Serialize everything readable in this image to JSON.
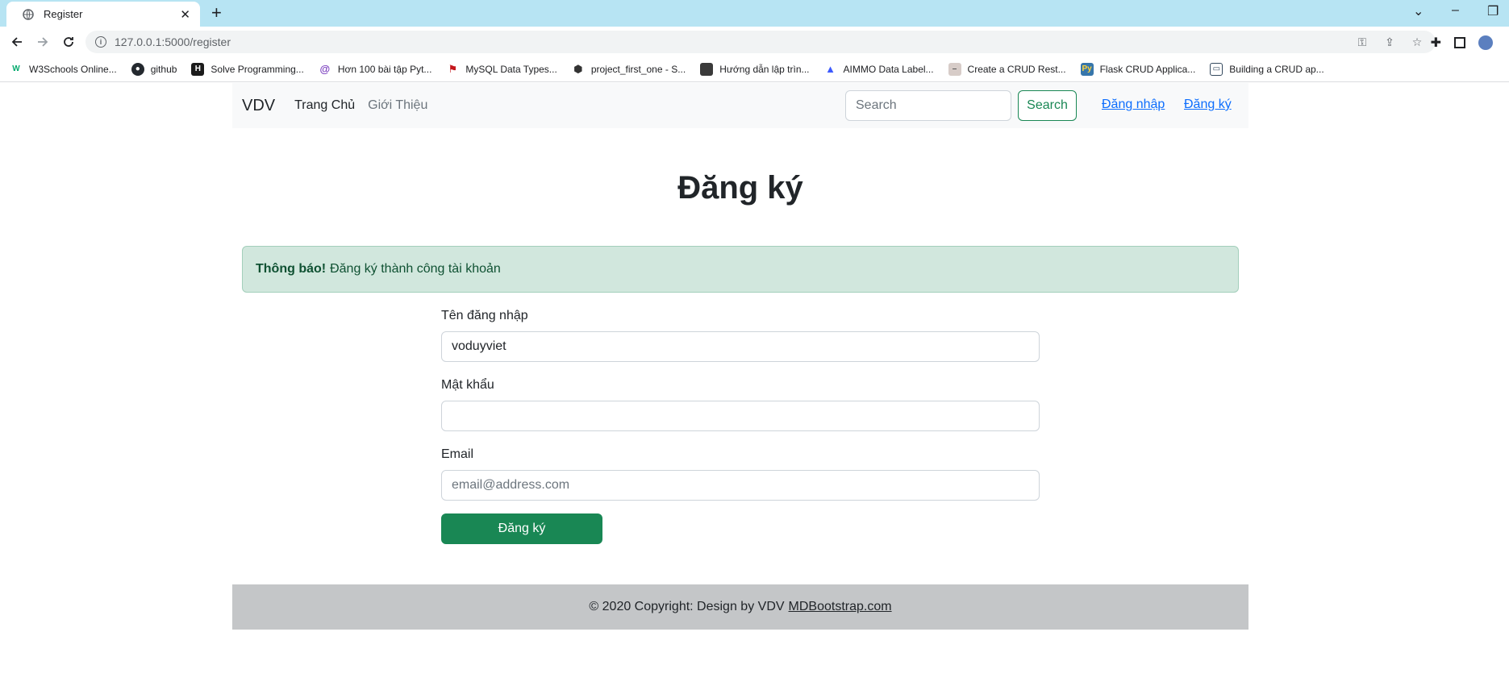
{
  "browser": {
    "tab_title": "Register",
    "url": "127.0.0.1:5000/register",
    "bookmarks": [
      {
        "label": "W3Schools Online...",
        "icon": "w3schools-icon",
        "color": "#04aa6d"
      },
      {
        "label": "github",
        "icon": "github-icon",
        "color": "#24292f"
      },
      {
        "label": "Solve Programming...",
        "icon": "hackerrank-icon",
        "color": "#1b1b1b"
      },
      {
        "label": "Hơn 100 bài tập Pyt...",
        "icon": "at-icon",
        "color": "#7b3fbf"
      },
      {
        "label": "MySQL Data Types...",
        "icon": "flag-icon",
        "color": "#c4161c"
      },
      {
        "label": "project_first_one - S...",
        "icon": "package-icon",
        "color": "#333333"
      },
      {
        "label": "Hướng dẫn lập trìn...",
        "icon": "avatar-icon",
        "color": "#3a3a3a"
      },
      {
        "label": "AIMMO Data Label...",
        "icon": "aimmo-icon",
        "color": "#3d5afe"
      },
      {
        "label": "Create a CRUD Rest...",
        "icon": "page-icon",
        "color": "#d7ccc8"
      },
      {
        "label": "Flask CRUD Applica...",
        "icon": "python-icon",
        "color": "#3776ab"
      },
      {
        "label": "Building a CRUD ap...",
        "icon": "card-icon",
        "color": "#34495e"
      }
    ]
  },
  "navbar": {
    "brand": "VDV",
    "links": [
      "Trang Chủ",
      "Giới Thiệu"
    ],
    "search_placeholder": "Search",
    "search_button": "Search",
    "login": "Đăng nhập",
    "register": "Đăng ký"
  },
  "main": {
    "heading": "Đăng ký",
    "alert_strong": "Thông báo!",
    "alert_text": "Đăng ký thành công tài khoản",
    "username_label": "Tên đăng nhập",
    "username_value": "voduyviet",
    "password_label": "Mật khẩu",
    "password_value": "",
    "email_label": "Email",
    "email_placeholder": "email@address.com",
    "submit": "Đăng ký"
  },
  "footer": {
    "text": "© 2020 Copyright: Design by VDV",
    "link": "MDBootstrap.com"
  },
  "colors": {
    "primary": "#0d6efd",
    "success": "#198754",
    "alert_bg": "#d1e7dd",
    "footer_bg": "#c4c6c8",
    "tabstrip": "#b7e4f3"
  }
}
